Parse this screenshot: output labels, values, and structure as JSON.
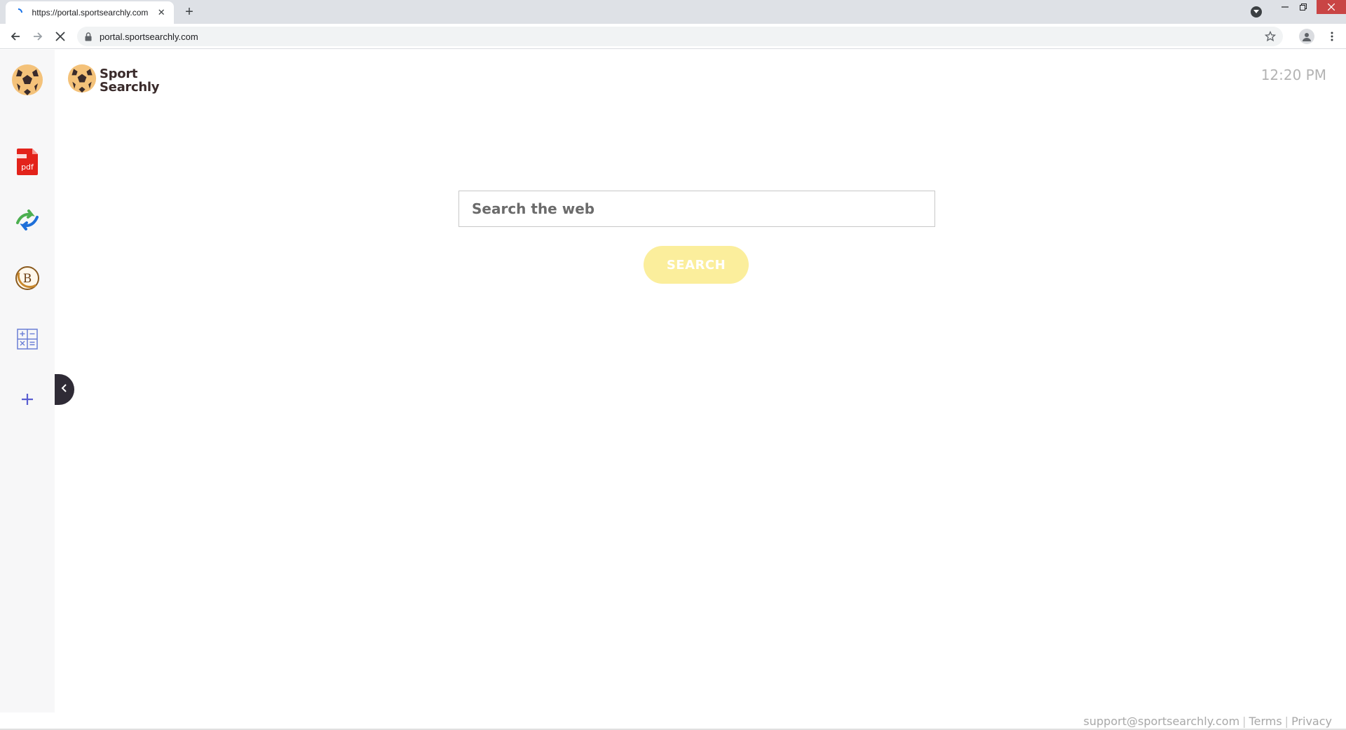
{
  "browser": {
    "tab": {
      "title": "https://portal.sportsearchly.com",
      "close_label": "✕"
    },
    "new_tab_label": "+",
    "address_bar": {
      "url": "portal.sportsearchly.com"
    }
  },
  "page": {
    "logo": {
      "line1": "Sport",
      "line2": "Searchly"
    },
    "clock": "12:20 PM",
    "search": {
      "placeholder": "Search the web",
      "button_label": "SEARCH"
    },
    "footer": {
      "email": "support@sportsearchly.com",
      "separator": "|",
      "terms": "Terms",
      "privacy": "Privacy"
    },
    "sidebar": {
      "items": [
        {
          "icon": "soccer-ball-icon"
        },
        {
          "icon": "pdf-icon",
          "text": "pdf"
        },
        {
          "icon": "converter-arrows-icon"
        },
        {
          "icon": "bitcoin-icon",
          "text": "B"
        },
        {
          "icon": "calculator-icon"
        },
        {
          "icon": "plus-icon",
          "text": "+"
        }
      ]
    }
  },
  "colors": {
    "search_button": "#fbee9c",
    "sidebar_bg": "#f7f7f8",
    "toggle_bg": "#2f2b36",
    "close_button": "#c94545"
  }
}
